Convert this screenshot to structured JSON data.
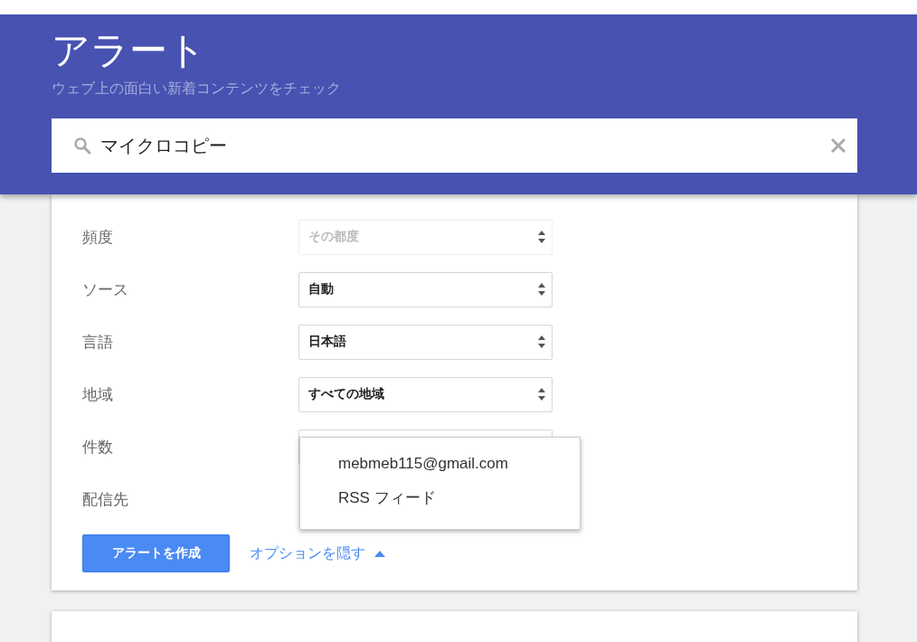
{
  "header": {
    "title": "アラート",
    "subtitle": "ウェブ上の面白い新着コンテンツをチェック"
  },
  "search": {
    "value": "マイクロコピー"
  },
  "options": [
    {
      "label": "頻度",
      "kind": "select",
      "value": "その都度",
      "disabled": true
    },
    {
      "label": "ソース",
      "kind": "select",
      "value": "自動",
      "disabled": false
    },
    {
      "label": "言語",
      "kind": "select",
      "value": "日本語",
      "disabled": false
    },
    {
      "label": "地域",
      "kind": "select",
      "value": "すべての地域",
      "disabled": false
    },
    {
      "label": "件数",
      "kind": "covered-select"
    },
    {
      "label": "配信先",
      "kind": "menu-anchor"
    }
  ],
  "delivery_menu": {
    "options": [
      "mebmeb115@gmail.com",
      "RSS フィード"
    ]
  },
  "create_button": "アラートを作成",
  "options_link": "オプションを隠す"
}
